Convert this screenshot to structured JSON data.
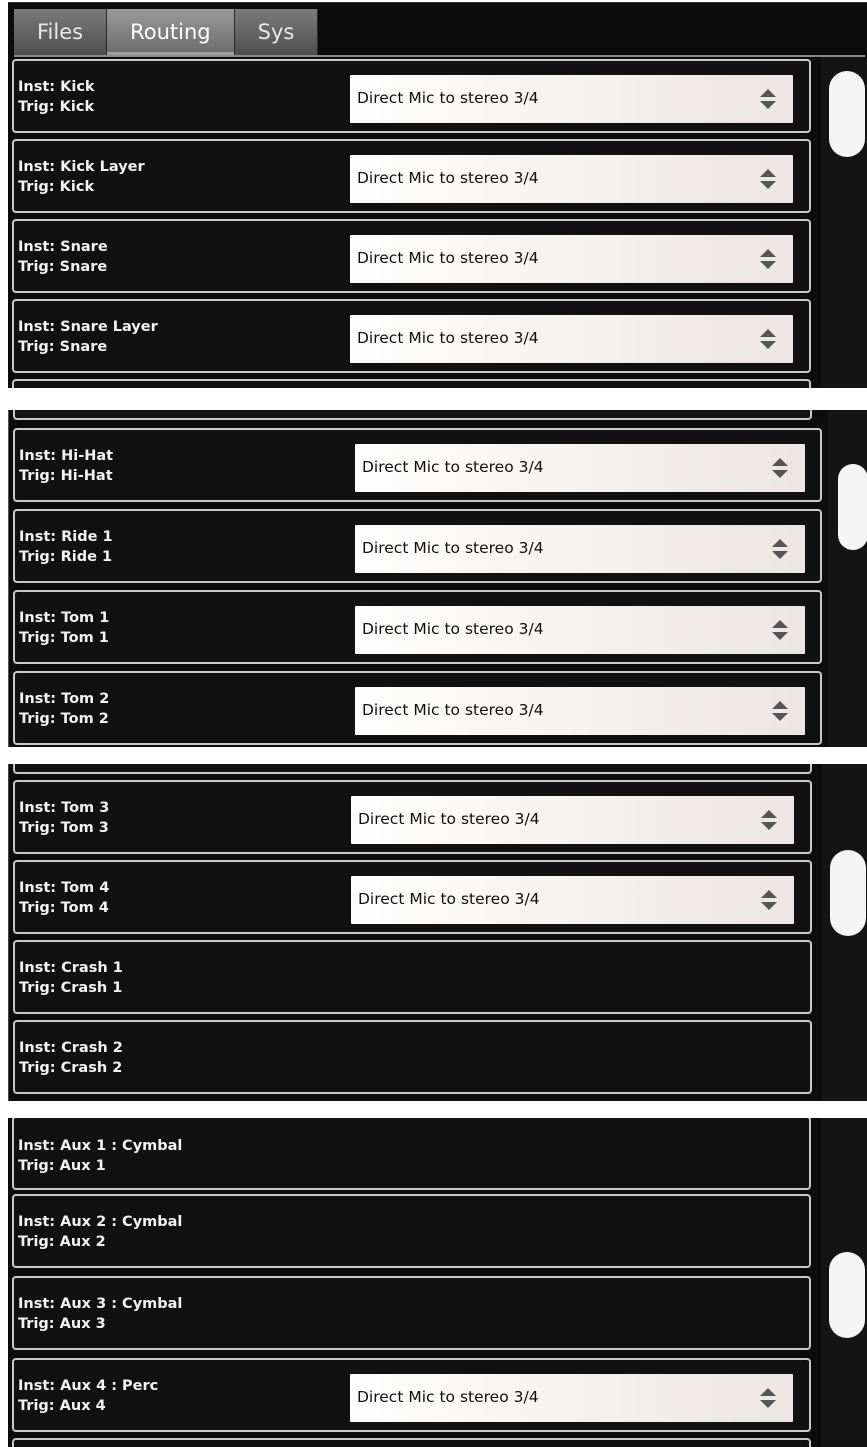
{
  "tabs": [
    {
      "label": "Files",
      "active": false
    },
    {
      "label": "Routing",
      "active": true
    },
    {
      "label": "Sys",
      "active": false
    }
  ],
  "routing_options": {
    "default": "Direct Mic to stereo 3/4"
  },
  "panel1": {
    "rows": [
      {
        "inst": "Inst: Kick",
        "trig": "Trig: Kick",
        "route": "Direct Mic to stereo 3/4"
      },
      {
        "inst": "Inst: Kick Layer",
        "trig": "Trig: Kick",
        "route": "Direct Mic to stereo 3/4"
      },
      {
        "inst": "Inst: Snare",
        "trig": "Trig: Snare",
        "route": "Direct Mic to stereo 3/4"
      },
      {
        "inst": "Inst: Snare Layer",
        "trig": "Trig: Snare",
        "route": "Direct Mic to stereo 3/4"
      }
    ]
  },
  "panel2": {
    "rows": [
      {
        "inst": "Inst: Hi-Hat",
        "trig": "Trig: Hi-Hat",
        "route": "Direct Mic to stereo 3/4"
      },
      {
        "inst": "Inst: Ride 1",
        "trig": "Trig: Ride 1",
        "route": "Direct Mic to stereo 3/4"
      },
      {
        "inst": "Inst: Tom 1",
        "trig": "Trig: Tom 1",
        "route": "Direct Mic to stereo 3/4"
      },
      {
        "inst": "Inst: Tom 2",
        "trig": "Trig: Tom 2",
        "route": "Direct Mic to stereo 3/4"
      }
    ]
  },
  "panel3": {
    "rows": [
      {
        "inst": "Inst: Tom 3",
        "trig": "Trig: Tom 3",
        "route": "Direct Mic to stereo 3/4"
      },
      {
        "inst": "Inst: Tom 4",
        "trig": "Trig: Tom 4",
        "route": "Direct Mic to stereo 3/4"
      },
      {
        "inst": "Inst: Crash 1",
        "trig": "Trig: Crash 1",
        "route": ""
      },
      {
        "inst": "Inst: Crash 2",
        "trig": "Trig: Crash 2",
        "route": ""
      }
    ]
  },
  "panel4": {
    "rows": [
      {
        "inst": "Inst: Aux 1 : Cymbal",
        "trig": "Trig: Aux 1",
        "route": ""
      },
      {
        "inst": "Inst: Aux 2 : Cymbal",
        "trig": "Trig: Aux 2",
        "route": ""
      },
      {
        "inst": "Inst: Aux 3 : Cymbal",
        "trig": "Trig: Aux 3",
        "route": ""
      },
      {
        "inst": "Inst: Aux 4 : Perc",
        "trig": "Trig: Aux 4",
        "route": "Direct Mic to stereo 3/4"
      }
    ]
  },
  "icons": {
    "dropdown": "up-down-spinner-icon"
  },
  "colors": {
    "background": "#0c0c0c",
    "row_border": "#c9c9c9",
    "text": "#f2f2f2",
    "dropdown_bg": "#f4f1ee",
    "scroll_thumb": "#f5f5f5"
  }
}
